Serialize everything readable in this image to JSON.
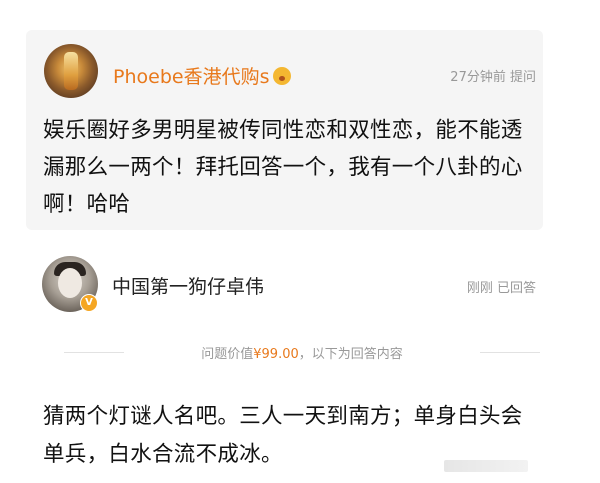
{
  "question": {
    "author": "Phoebe香港代购s",
    "time": "27分钟前",
    "action": "提问",
    "text": "娱乐圈好多男明星被传同性恋和双性恋，能不能透漏那么一两个！拜托回答一个，我有一个八卦的心啊！哈哈"
  },
  "answerer": {
    "name": "中国第一狗仔卓伟",
    "time": "刚刚",
    "status": "已回答",
    "verified_badge": "V"
  },
  "price": {
    "prefix": "问题价值",
    "amount": "¥99.00",
    "suffix": "，以下为回答内容"
  },
  "answer": {
    "text": "猜两个灯谜人名吧。三人一天到南方；单身白头会单兵，白水合流不成冰。"
  },
  "colors": {
    "accent": "#e8791c",
    "meta": "#999999",
    "text": "#111111",
    "card": "#f5f5f5"
  }
}
